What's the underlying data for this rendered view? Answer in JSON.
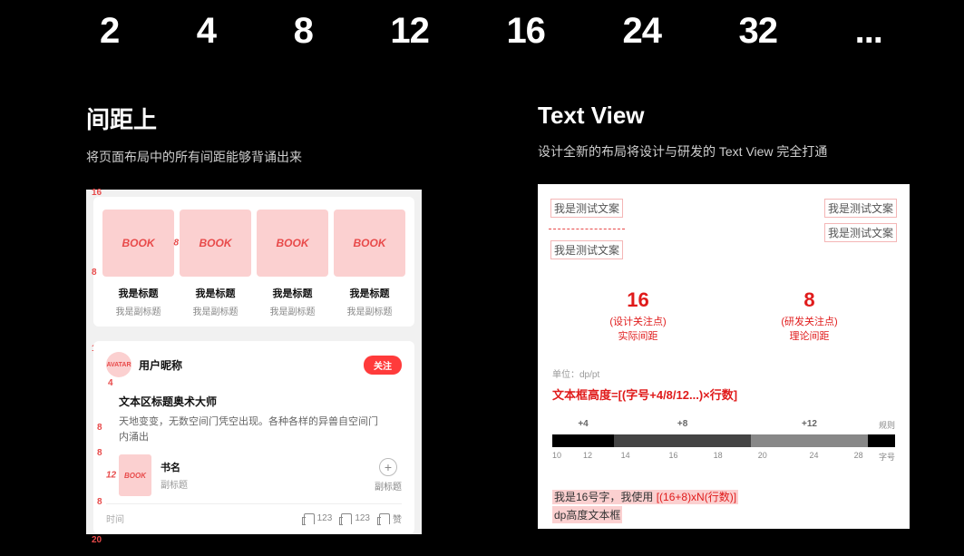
{
  "scale": [
    "2",
    "4",
    "8",
    "12",
    "16",
    "24",
    "32",
    "..."
  ],
  "left": {
    "title": "间距上",
    "subtitle": "将页面布局中的所有间距能够背诵出来",
    "g16": "16",
    "g8": "8",
    "g20": "20",
    "g12": "12",
    "g4": "4",
    "book_label": "BOOK",
    "card_title": "我是标题",
    "card_sub": "我是副标题",
    "avatar_text": "AVATAR",
    "nickname": "用户昵称",
    "follow": "关注",
    "post_title": "文本区标题奥术大师",
    "post_body": "天地变变，无数空间门凭空出现。各种各样的异兽自空间门内涌出",
    "book_name": "书名",
    "book_sub": "副标题",
    "add_sub": "副标题",
    "time": "时间",
    "like_count": "123",
    "like_label": "赞"
  },
  "right": {
    "title": "Text View",
    "subtitle": "设计全新的布局将设计与研发的 Text View 完全打通",
    "test_text": "我是测试文案",
    "metric1_num": "16",
    "metric1_l1": "(设计关注点)",
    "metric1_l2": "实际间距",
    "metric2_num": "8",
    "metric2_l1": "(研发关注点)",
    "metric2_l2": "理论间距",
    "unit": "单位：dp/pt",
    "formula": "文本框高度=[(字号+4/8/12...)×行数]",
    "seg_p4": "+4",
    "seg_p8": "+8",
    "seg_p12": "+12",
    "rule_label": "规则",
    "axis_label": "字号",
    "ticks": [
      "10",
      "12",
      "14",
      "16",
      "18",
      "20",
      "24",
      "28"
    ],
    "sample_prefix": "我是16号字，我使用",
    "sample_expr": "[(16+8)xN(行数)]",
    "sample_line2": "dp高度文本框"
  }
}
